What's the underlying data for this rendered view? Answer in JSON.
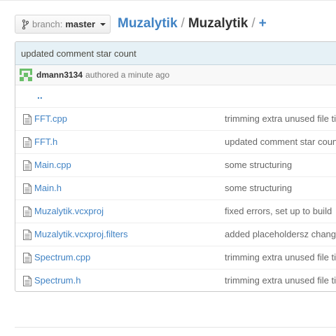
{
  "branch": {
    "prefix": "branch:",
    "name": "master"
  },
  "breadcrumb": {
    "owner": "Muzalytik",
    "separator": "/",
    "repo": "Muzalytik",
    "add": "+"
  },
  "commit": {
    "message": "updated comment star count",
    "author": "dmann3134",
    "authored_text": "authored a minute ago"
  },
  "parent_link": "..",
  "files": [
    {
      "name": "FFT.cpp",
      "message": "trimming extra unused file ti"
    },
    {
      "name": "FFT.h",
      "message": "updated comment star coun"
    },
    {
      "name": "Main.cpp",
      "message": "some structuring"
    },
    {
      "name": "Main.h",
      "message": "some structuring"
    },
    {
      "name": "Muzalytik.vcxproj",
      "message": "fixed errors, set up to build"
    },
    {
      "name": "Muzalytik.vcxproj.filters",
      "message": "added placeholdersz change"
    },
    {
      "name": "Spectrum.cpp",
      "message": "trimming extra unused file ti"
    },
    {
      "name": "Spectrum.h",
      "message": "trimming extra unused file ti"
    }
  ],
  "colors": {
    "link": "#4183c4",
    "commit_bg": "#e6f1f6",
    "avatar": "#6abf69"
  },
  "icons": {
    "branch": "branch-icon",
    "file": "file-icon",
    "avatar": "identicon-avatar"
  }
}
